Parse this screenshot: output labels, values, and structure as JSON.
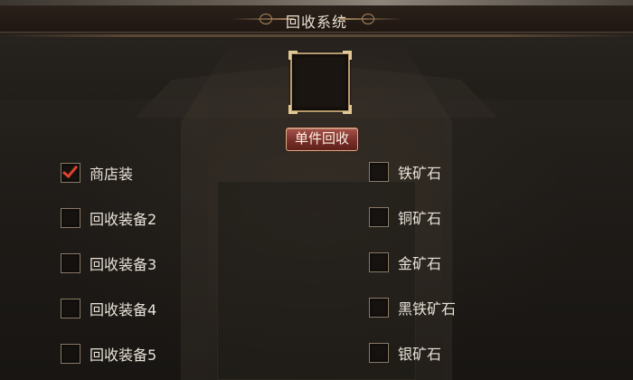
{
  "panel": {
    "title": "回收系统",
    "recycle_single_label": "单件回收"
  },
  "left_options": [
    {
      "label": "商店装",
      "checked": true
    },
    {
      "label": "回收装备2",
      "checked": false
    },
    {
      "label": "回收装备3",
      "checked": false
    },
    {
      "label": "回收装备4",
      "checked": false
    },
    {
      "label": "回收装备5",
      "checked": false
    }
  ],
  "right_options": [
    {
      "label": "铁矿石",
      "checked": false
    },
    {
      "label": "铜矿石",
      "checked": false
    },
    {
      "label": "金矿石",
      "checked": false
    },
    {
      "label": "黑铁矿石",
      "checked": false
    },
    {
      "label": "银矿石",
      "checked": false
    }
  ],
  "colors": {
    "check": "#e0432f",
    "button": "#8a3a33",
    "frame": "#b79a6c"
  }
}
